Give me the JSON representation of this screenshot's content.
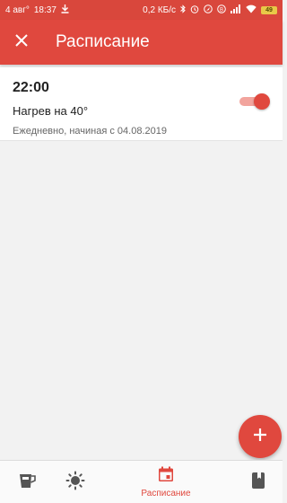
{
  "status_bar": {
    "date": "4 авг°",
    "time": "18:37",
    "download_icon": "download-icon",
    "network_speed": "0,2 КБ/с",
    "battery": "49"
  },
  "app_bar": {
    "close_icon": "close-icon",
    "title": "Расписание"
  },
  "schedule": [
    {
      "time": "22:00",
      "name": "Нагрев на 40°",
      "description": "Ежедневно, начиная с 04.08.2019",
      "enabled": true
    }
  ],
  "fab": {
    "icon": "plus-icon"
  },
  "bottom_nav": {
    "items": [
      {
        "icon": "kettle-icon",
        "label": "",
        "active": false
      },
      {
        "icon": "brightness-icon",
        "label": "",
        "active": false
      },
      {
        "icon": "calendar-icon",
        "label": "Расписание",
        "active": true
      },
      {
        "icon": "book-icon",
        "label": "",
        "active": false
      }
    ]
  },
  "colors": {
    "accent": "#e0483e",
    "status_bar": "#d9473c",
    "toggle_track": "#f2a49d",
    "background": "#f2f2f2",
    "icon_inactive": "#555555"
  }
}
